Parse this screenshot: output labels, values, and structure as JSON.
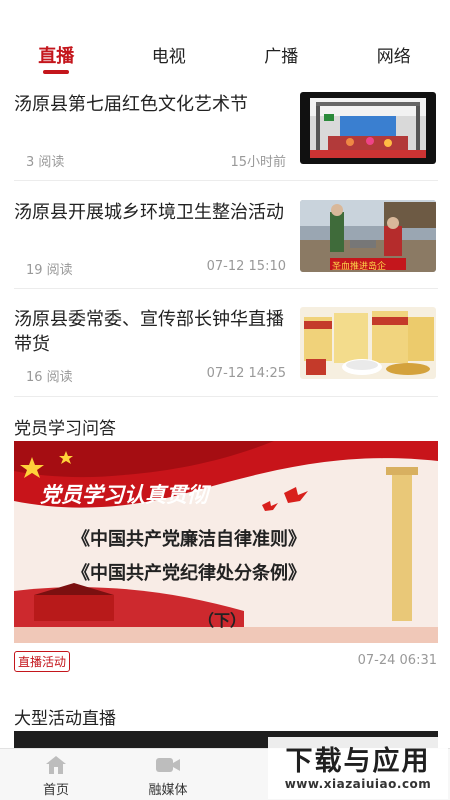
{
  "tabs": [
    {
      "label": "直播",
      "active": true
    },
    {
      "label": "电视",
      "active": false
    },
    {
      "label": "广播",
      "active": false
    },
    {
      "label": "网络",
      "active": false
    }
  ],
  "news": [
    {
      "title": "汤原县第七届红色文化艺术节",
      "reads": "3 阅读",
      "time": "15小时前",
      "thumb": "stage-performance"
    },
    {
      "title": "汤原县开展城乡环境卫生整治活动",
      "reads": "19 阅读",
      "time": "07-12 15:10",
      "thumb": "volunteers-cleaning",
      "thumb_text": "圣血推进岛企"
    },
    {
      "title": "汤原县委常委、宣传部长钟华直播带货",
      "reads": "16 阅读",
      "time": "07-12 14:25",
      "thumb": "rice-products"
    }
  ],
  "section1": {
    "title": "党员学习问答",
    "banner": {
      "line1": "党员学习认真贯彻",
      "line2": "《中国共产党廉洁自律准则》",
      "line3": "《中国共产党纪律处分条例》",
      "line4": "（下）"
    },
    "tag": "直播活动",
    "date": "07-24 06:31"
  },
  "section2": {
    "title": "大型活动直播"
  },
  "bottom_nav": [
    {
      "label": "首页",
      "icon": "home-icon"
    },
    {
      "label": "融媒体",
      "icon": "video-camera-icon"
    }
  ],
  "watermark": {
    "main": "下载与应用",
    "sub": "www.xiazaiuiao.com"
  },
  "colors": {
    "accent": "#c4161c",
    "muted": "#999999"
  }
}
